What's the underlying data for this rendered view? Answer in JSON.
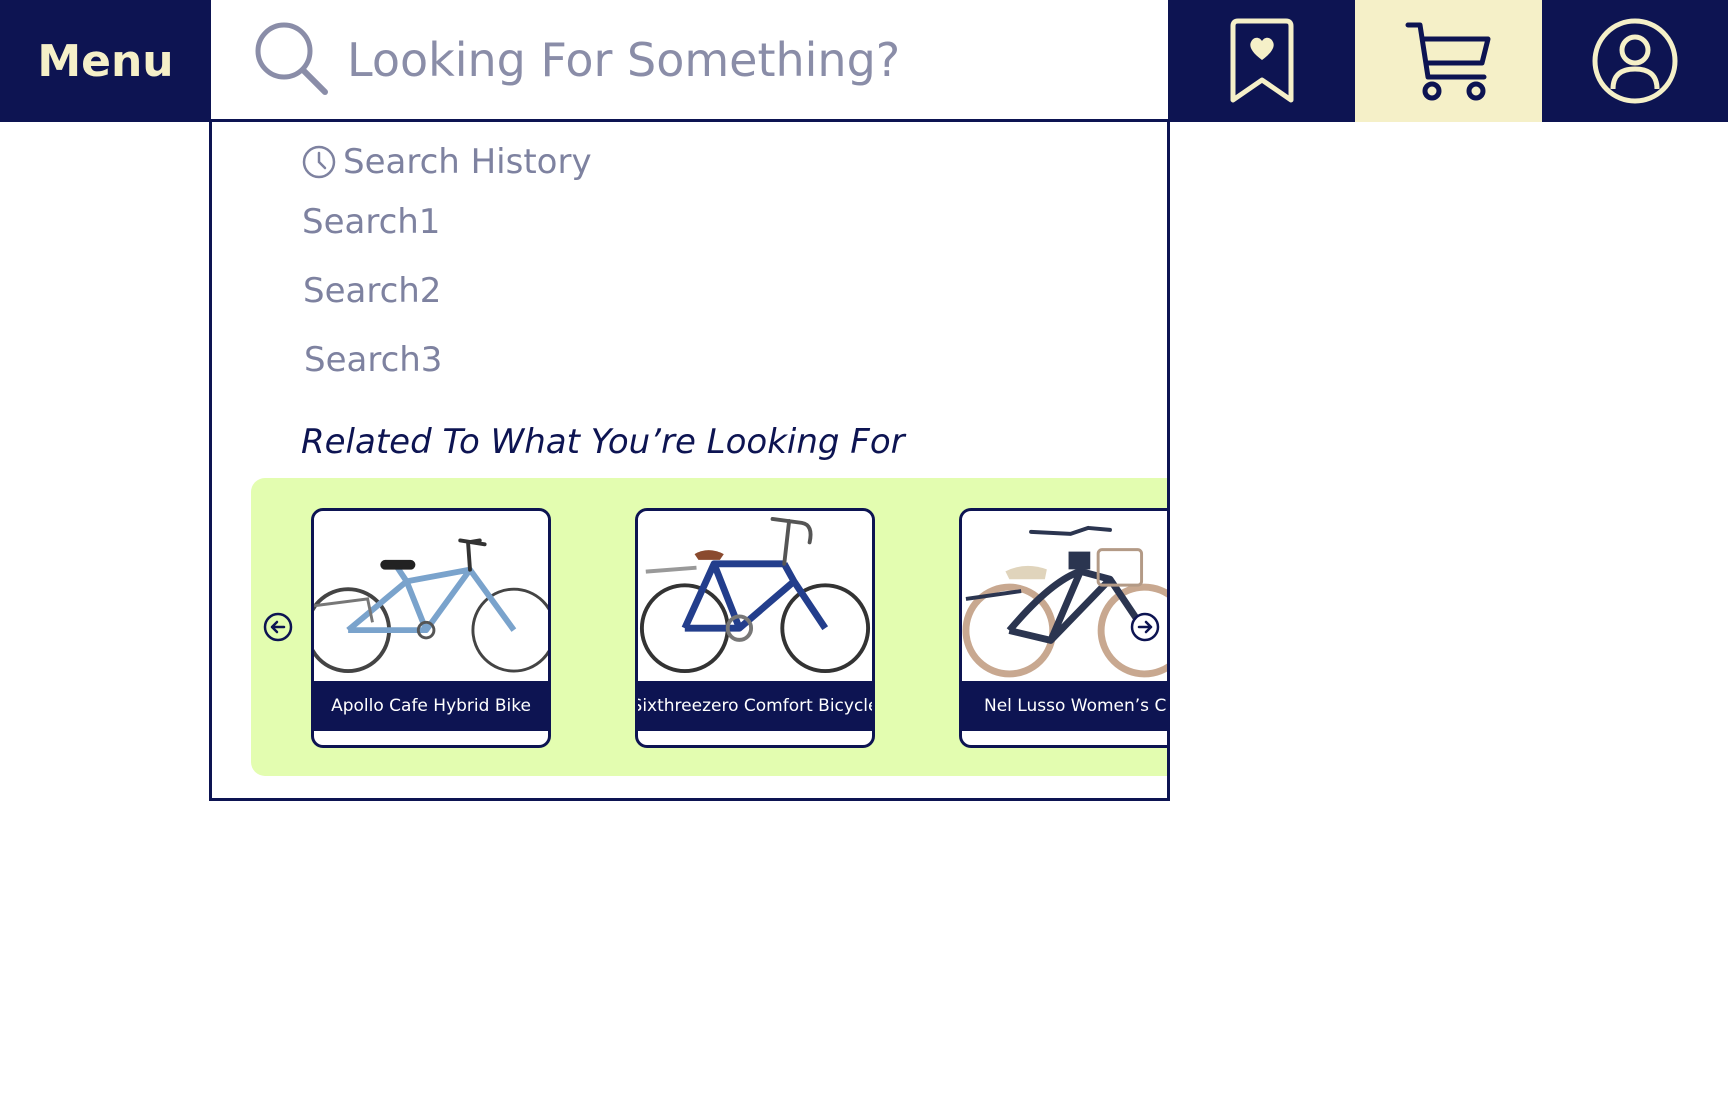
{
  "header": {
    "menu_label": "Menu",
    "search_placeholder": "Looking For Something?",
    "icons": {
      "search": "search-icon",
      "wishlist": "bookmark-heart-icon",
      "cart": "cart-icon",
      "account": "user-icon"
    }
  },
  "dropdown": {
    "history_title": "Search History",
    "history": [
      {
        "label": "Search1"
      },
      {
        "label": "Search2"
      },
      {
        "label": "Search3"
      }
    ],
    "related_title": "Related To What You’re Looking For",
    "products": [
      {
        "name": "Apollo Cafe Hybrid Bike",
        "frame_color": "#7aa3cc",
        "tire_color": "#444444"
      },
      {
        "name": "Sixthreezero Comfort Bicycle",
        "frame_color": "#233e8c",
        "tire_color": "#333333"
      },
      {
        "name": "Nel Lusso Women’s Cruiser",
        "frame_color": "#2b3550",
        "tire_color": "#c8a890"
      }
    ]
  },
  "colors": {
    "navy": "#0d1452",
    "cream": "#f5f0c8",
    "muted_text": "#7e82a0",
    "carousel_bg": "#e3fdb0"
  }
}
